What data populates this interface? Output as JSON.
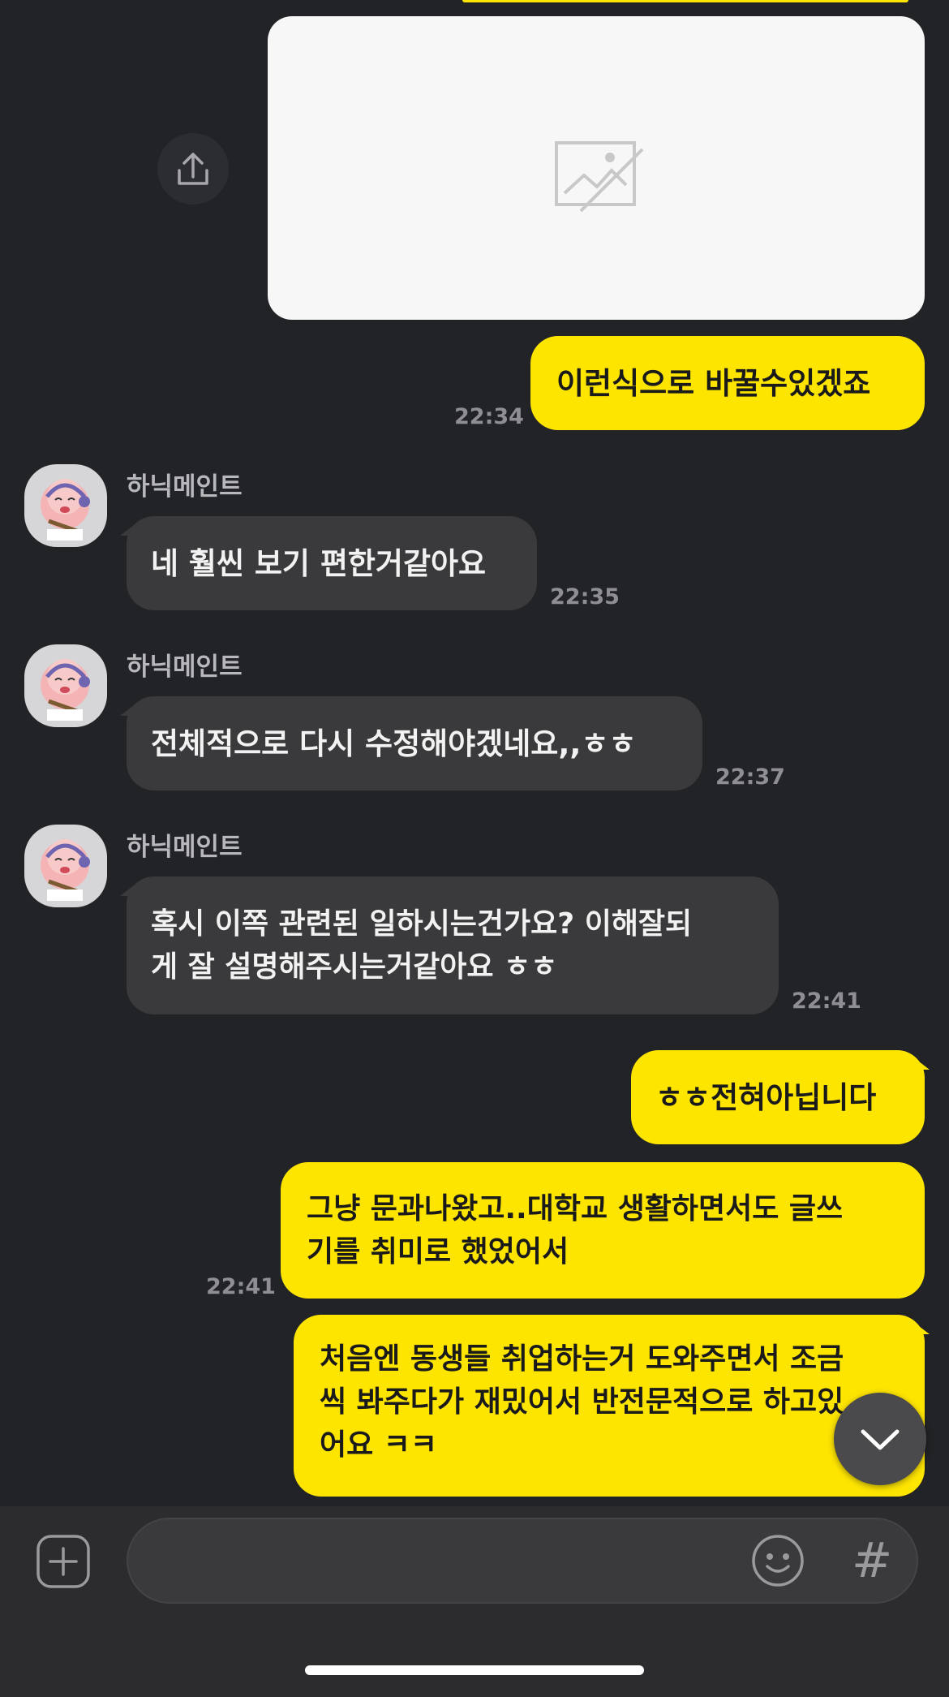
{
  "chat": {
    "msg1": {
      "text": "이런식으로 바꿀수있겠죠",
      "time": "22:34"
    },
    "msg2": {
      "sender": "하닉메인트",
      "text": "네 훨씬 보기 편한거같아요",
      "time": "22:35"
    },
    "msg3": {
      "sender": "하닉메인트",
      "text": "전체적으로 다시 수정해야겠네요,,ㅎㅎ",
      "time": "22:37"
    },
    "msg4": {
      "sender": "하닉메인트",
      "lines": [
        "혹시 이쪽 관련된 일하시는건가요? 이해잘되",
        "게 잘 설명해주시는거같아요 ㅎㅎ"
      ],
      "time": "22:41"
    },
    "msg5": {
      "text": "ㅎㅎ전혀아닙니다"
    },
    "msg6": {
      "lines": [
        "그냥 문과나왔고..대학교 생활하면서도 글쓰",
        "기를 취미로 했었어서"
      ],
      "time": "22:41"
    },
    "msg7": {
      "lines": [
        "처음엔 동생들 취업하는거 도와주면서 조금",
        "씩 봐주다가 재밌어서 반전문적으로 하고있",
        "어요 ㅋㅋ"
      ]
    }
  },
  "icons": {
    "share": "share-icon",
    "image_placeholder": "image-placeholder-icon",
    "scroll_down": "chevron-down-icon",
    "add": "plus-icon",
    "emoji": "emoji-icon",
    "hashtag": "hashtag-icon"
  },
  "input": {
    "hashtag_glyph": "#"
  },
  "colors": {
    "background": "#222326",
    "my_bubble": "#fee500",
    "other_bubble": "#3a3a3c"
  }
}
